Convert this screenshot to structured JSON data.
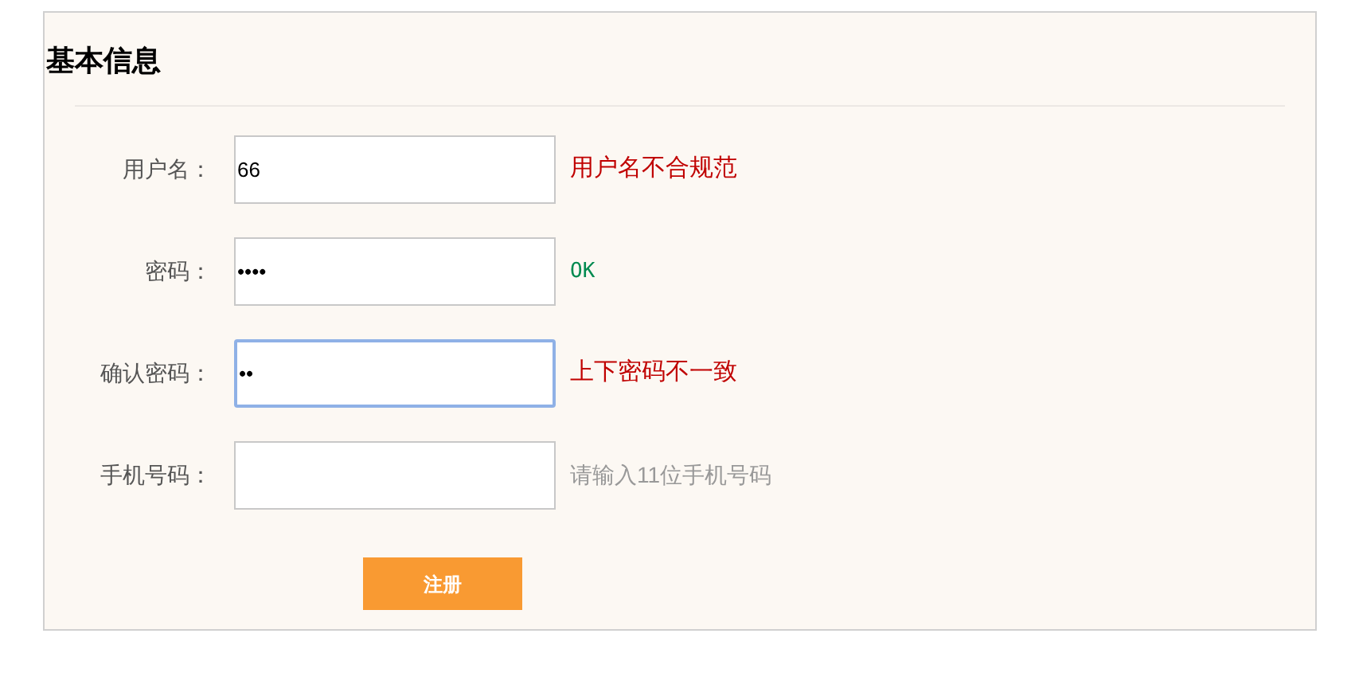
{
  "title": "基本信息",
  "fields": [
    {
      "label": "用户名：",
      "value": "66",
      "focused": false,
      "message": {
        "kind": "error",
        "text": "用户名不合规范"
      }
    },
    {
      "label": "密码：",
      "value": "••••",
      "focused": false,
      "message": {
        "kind": "ok",
        "text": "OK"
      }
    },
    {
      "label": "确认密码：",
      "value": "••",
      "focused": true,
      "message": {
        "kind": "error",
        "text": "上下密码不一致"
      }
    },
    {
      "label": "手机号码：",
      "focused": false,
      "message": {
        "kind": "hint",
        "text": "请输入11位手机号码"
      }
    }
  ],
  "submit": "注册"
}
